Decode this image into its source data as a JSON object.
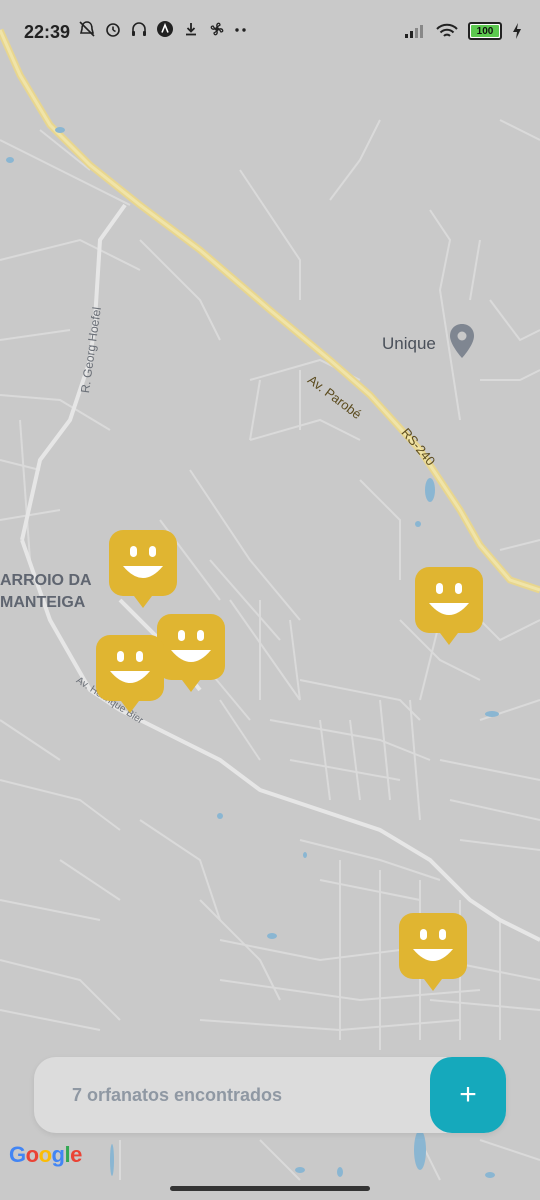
{
  "status_bar": {
    "time": "22:39",
    "icons_left": [
      "bell-off-icon",
      "alarm-icon",
      "headphones-icon",
      "app-a-icon",
      "download-icon",
      "fan-icon",
      "more-icon"
    ],
    "icons_right": [
      "signal-icon",
      "wifi-icon",
      "battery-icon",
      "charging-icon"
    ],
    "battery_level": "100"
  },
  "map": {
    "roads": {
      "highway_label_1": "Av. Parobé",
      "highway_label_2": "RS-240",
      "street_label_1": "R. Georg Hoefel",
      "street_label_2": "Av. Henrique Bier"
    },
    "poi": {
      "name": "Unique"
    },
    "area": {
      "line1": "ARROIO DA",
      "line2": "MANTEIGA"
    },
    "pins": [
      {
        "label": "orphanage-1"
      },
      {
        "label": "orphanage-2"
      },
      {
        "label": "orphanage-3"
      },
      {
        "label": "orphanage-4"
      },
      {
        "label": "orphanage-5"
      }
    ],
    "pin_color": "#e0b531"
  },
  "footer": {
    "count_text": "7 orfanatos encontrados",
    "add_label": "+",
    "add_color": "#15a9bc"
  },
  "google": {
    "letters": [
      "G",
      "o",
      "o",
      "g",
      "l",
      "e"
    ]
  }
}
